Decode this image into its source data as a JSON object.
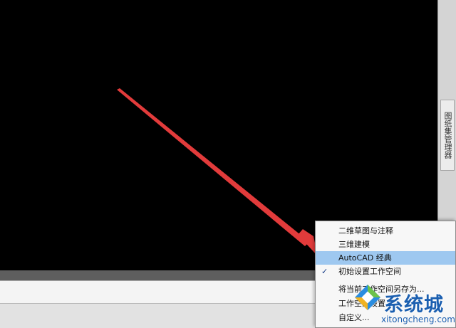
{
  "palette": {
    "tab_label": "图纸集管理器"
  },
  "workspace_menu": {
    "items": [
      {
        "label": "二维草图与注释",
        "checked": false,
        "highlighted": false
      },
      {
        "label": "三维建模",
        "checked": false,
        "highlighted": false
      },
      {
        "label": "AutoCAD 经典",
        "checked": false,
        "highlighted": true
      },
      {
        "label": "初始设置工作空间",
        "checked": true,
        "highlighted": false
      },
      {
        "label": "将当前工作空间另存为...",
        "checked": false,
        "highlighted": false
      },
      {
        "label": "工作空间设置...",
        "checked": false,
        "highlighted": false
      },
      {
        "label": "自定义...",
        "checked": false,
        "highlighted": false
      }
    ],
    "check_glyph": "✓"
  },
  "status": {
    "gear_icon": "gear-icon",
    "gear_glyph": "⚙"
  },
  "watermark": {
    "title": "系统城",
    "url": "xitongcheng.com"
  },
  "colors": {
    "canvas": "#000000",
    "arrow": "#e23b3b",
    "highlight": "#9ec8f0",
    "watermark": "#1b5fb0"
  }
}
